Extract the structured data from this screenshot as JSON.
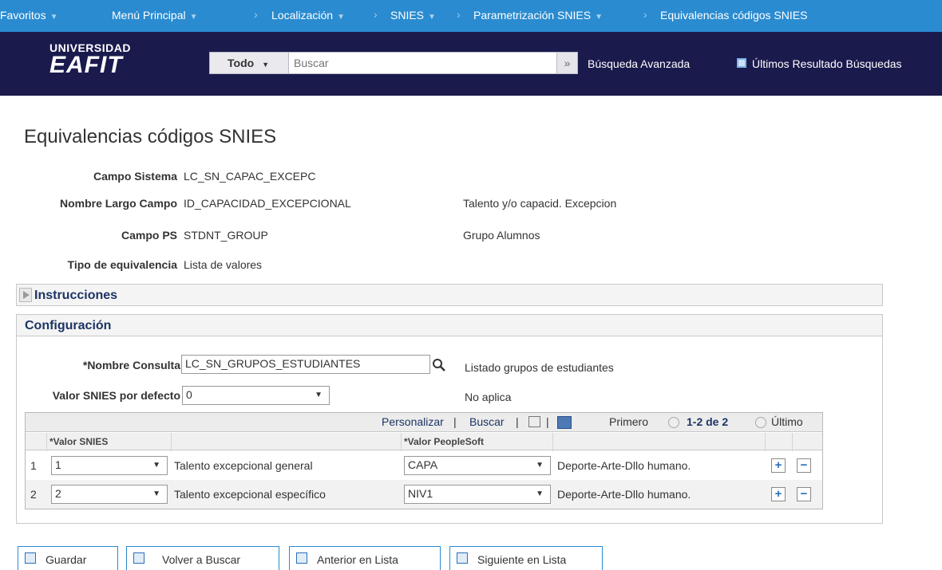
{
  "topnav": {
    "favoritos": "Favoritos",
    "menu": "Menú Principal",
    "breadcrumb": [
      "Localización",
      "SNIES",
      "Parametrización SNIES",
      "Equivalencias códigos SNIES"
    ]
  },
  "header": {
    "logo_line1": "UNIVERSIDAD",
    "logo_line2": "EAFIT",
    "search_scope": "Todo",
    "search_placeholder": "Buscar",
    "advanced_search": "Búsqueda Avanzada",
    "last_results": "Últimos Resultado Búsquedas"
  },
  "page": {
    "title": "Equivalencias códigos SNIES",
    "fields": {
      "campo_sistema_label": "Campo Sistema",
      "campo_sistema_value": "LC_SN_CAPAC_EXCEPC",
      "nombre_largo_label": "Nombre Largo Campo",
      "nombre_largo_value": "ID_CAPACIDAD_EXCEPCIONAL",
      "nombre_largo_desc": "Talento y/o capacid. Excepcion",
      "campo_ps_label": "Campo PS",
      "campo_ps_value": "STDNT_GROUP",
      "campo_ps_desc": "Grupo Alumnos",
      "tipo_equiv_label": "Tipo de equivalencia",
      "tipo_equiv_value": "Lista de valores"
    }
  },
  "instrucciones": {
    "title": "Instrucciones"
  },
  "configuracion": {
    "title": "Configuración",
    "nombre_consulta_label": "*Nombre Consulta",
    "nombre_consulta_value": "LC_SN_GRUPOS_ESTUDIANTES",
    "nombre_consulta_desc": "Listado grupos de estudiantes",
    "valor_defecto_label": "Valor SNIES por defecto",
    "valor_defecto_value": "0",
    "valor_defecto_desc": "No aplica"
  },
  "grid": {
    "personalizar": "Personalizar",
    "buscar": "Buscar",
    "primero": "Primero",
    "range": "1-2 de 2",
    "ultimo": "Último",
    "col_valor_snies": "*Valor SNIES",
    "col_valor_ps": "*Valor PeopleSoft",
    "rows": [
      {
        "num": "1",
        "snies": "1",
        "snies_desc": "Talento excepcional general",
        "ps": "CAPA",
        "ps_desc": "Deporte-Arte-Dllo humano."
      },
      {
        "num": "2",
        "snies": "2",
        "snies_desc": "Talento excepcional específico",
        "ps": "NIV1",
        "ps_desc": "Deporte-Arte-Dllo humano."
      }
    ]
  },
  "buttons": {
    "guardar": "Guardar",
    "volver": "Volver a Buscar",
    "anterior": "Anterior en Lista",
    "siguiente": "Siguiente en Lista"
  },
  "colors": {
    "topnav": "#2a8bd0",
    "header": "#1b1a4d",
    "section_title": "#1d3464"
  }
}
